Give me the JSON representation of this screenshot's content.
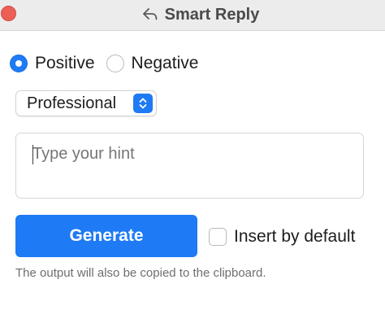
{
  "window": {
    "title": "Smart Reply",
    "title_icon": "reply-arrow-icon",
    "close_color": "#ec5f57"
  },
  "tone": {
    "options": [
      {
        "label": "Positive",
        "selected": true
      },
      {
        "label": "Negative",
        "selected": false
      }
    ]
  },
  "style_select": {
    "value": "Professional",
    "icon": "chevron-up-down-icon"
  },
  "hint": {
    "value": "",
    "placeholder": "Type your hint"
  },
  "actions": {
    "generate_label": "Generate",
    "insert_default_label": "Insert by default",
    "insert_default_checked": false
  },
  "footer": {
    "note": "The output will also be copied to the clipboard."
  },
  "colors": {
    "accent": "#1f7af5",
    "titlebar": "#ececec"
  }
}
